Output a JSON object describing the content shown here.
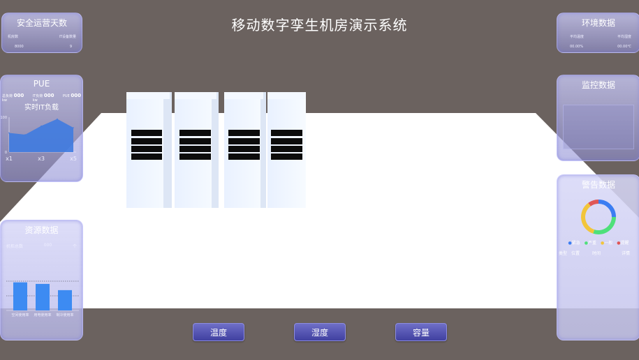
{
  "title": "移动数字孪生机房演示系统",
  "safe_panel": {
    "title": "安全运营天数",
    "headers": [
      "机房数",
      "IT设备数量"
    ],
    "values": [
      "8000",
      "9"
    ]
  },
  "pue_panel": {
    "title": "PUE",
    "stats": [
      {
        "label": "总负荷",
        "value": "000",
        "unit": "kw"
      },
      {
        "label": "IT负荷",
        "value": "000",
        "unit": "kw"
      },
      {
        "label": "PUE",
        "value": "000",
        "unit": ""
      }
    ],
    "subtitle": "实时IT负载",
    "chart_data": {
      "type": "area",
      "x": [
        "x1",
        "x2",
        "x3",
        "x4",
        "x5"
      ],
      "x_tick_labels": [
        "x1",
        "x3",
        "x5"
      ],
      "y_tick_labels": [
        "0",
        "100"
      ],
      "values": [
        55,
        50,
        75,
        95,
        70
      ],
      "ylim": [
        0,
        100
      ],
      "color": "#3f7be0"
    }
  },
  "resource_panel": {
    "title": "资源数据",
    "row_label": "机柜总数",
    "row_value": "000",
    "row_unit": "个",
    "chart_data": {
      "type": "bar",
      "categories": [
        "空间使用率",
        "用电使用率",
        "制冷使用率"
      ],
      "values": [
        72,
        68,
        52
      ],
      "ylim": [
        0,
        100
      ],
      "color": "#3d8bf2"
    }
  },
  "env_panel": {
    "title": "环境数据",
    "headers": [
      "平均温度",
      "平均湿度"
    ],
    "values": [
      "00.00%",
      "00.00℃"
    ]
  },
  "monitor_panel": {
    "title": "监控数据"
  },
  "warning_panel": {
    "title": "警告数据",
    "legend": [
      {
        "label": "紧急",
        "color": "#3b7df2"
      },
      {
        "label": "严重",
        "color": "#4ee07a"
      },
      {
        "label": "一般",
        "color": "#f2c53b"
      },
      {
        "label": "提醒",
        "color": "#e05656"
      }
    ],
    "columns": [
      "类型",
      "位置",
      "时间",
      "详情"
    ],
    "chart_data": {
      "type": "pie",
      "categories": [
        "紧急",
        "严重",
        "一般",
        "提醒"
      ],
      "values": [
        25,
        30,
        35,
        10
      ],
      "colors": [
        "#3b7df2",
        "#4ee07a",
        "#f2c53b",
        "#e05656"
      ]
    }
  },
  "buttons": [
    "温度",
    "湿度",
    "容量"
  ]
}
